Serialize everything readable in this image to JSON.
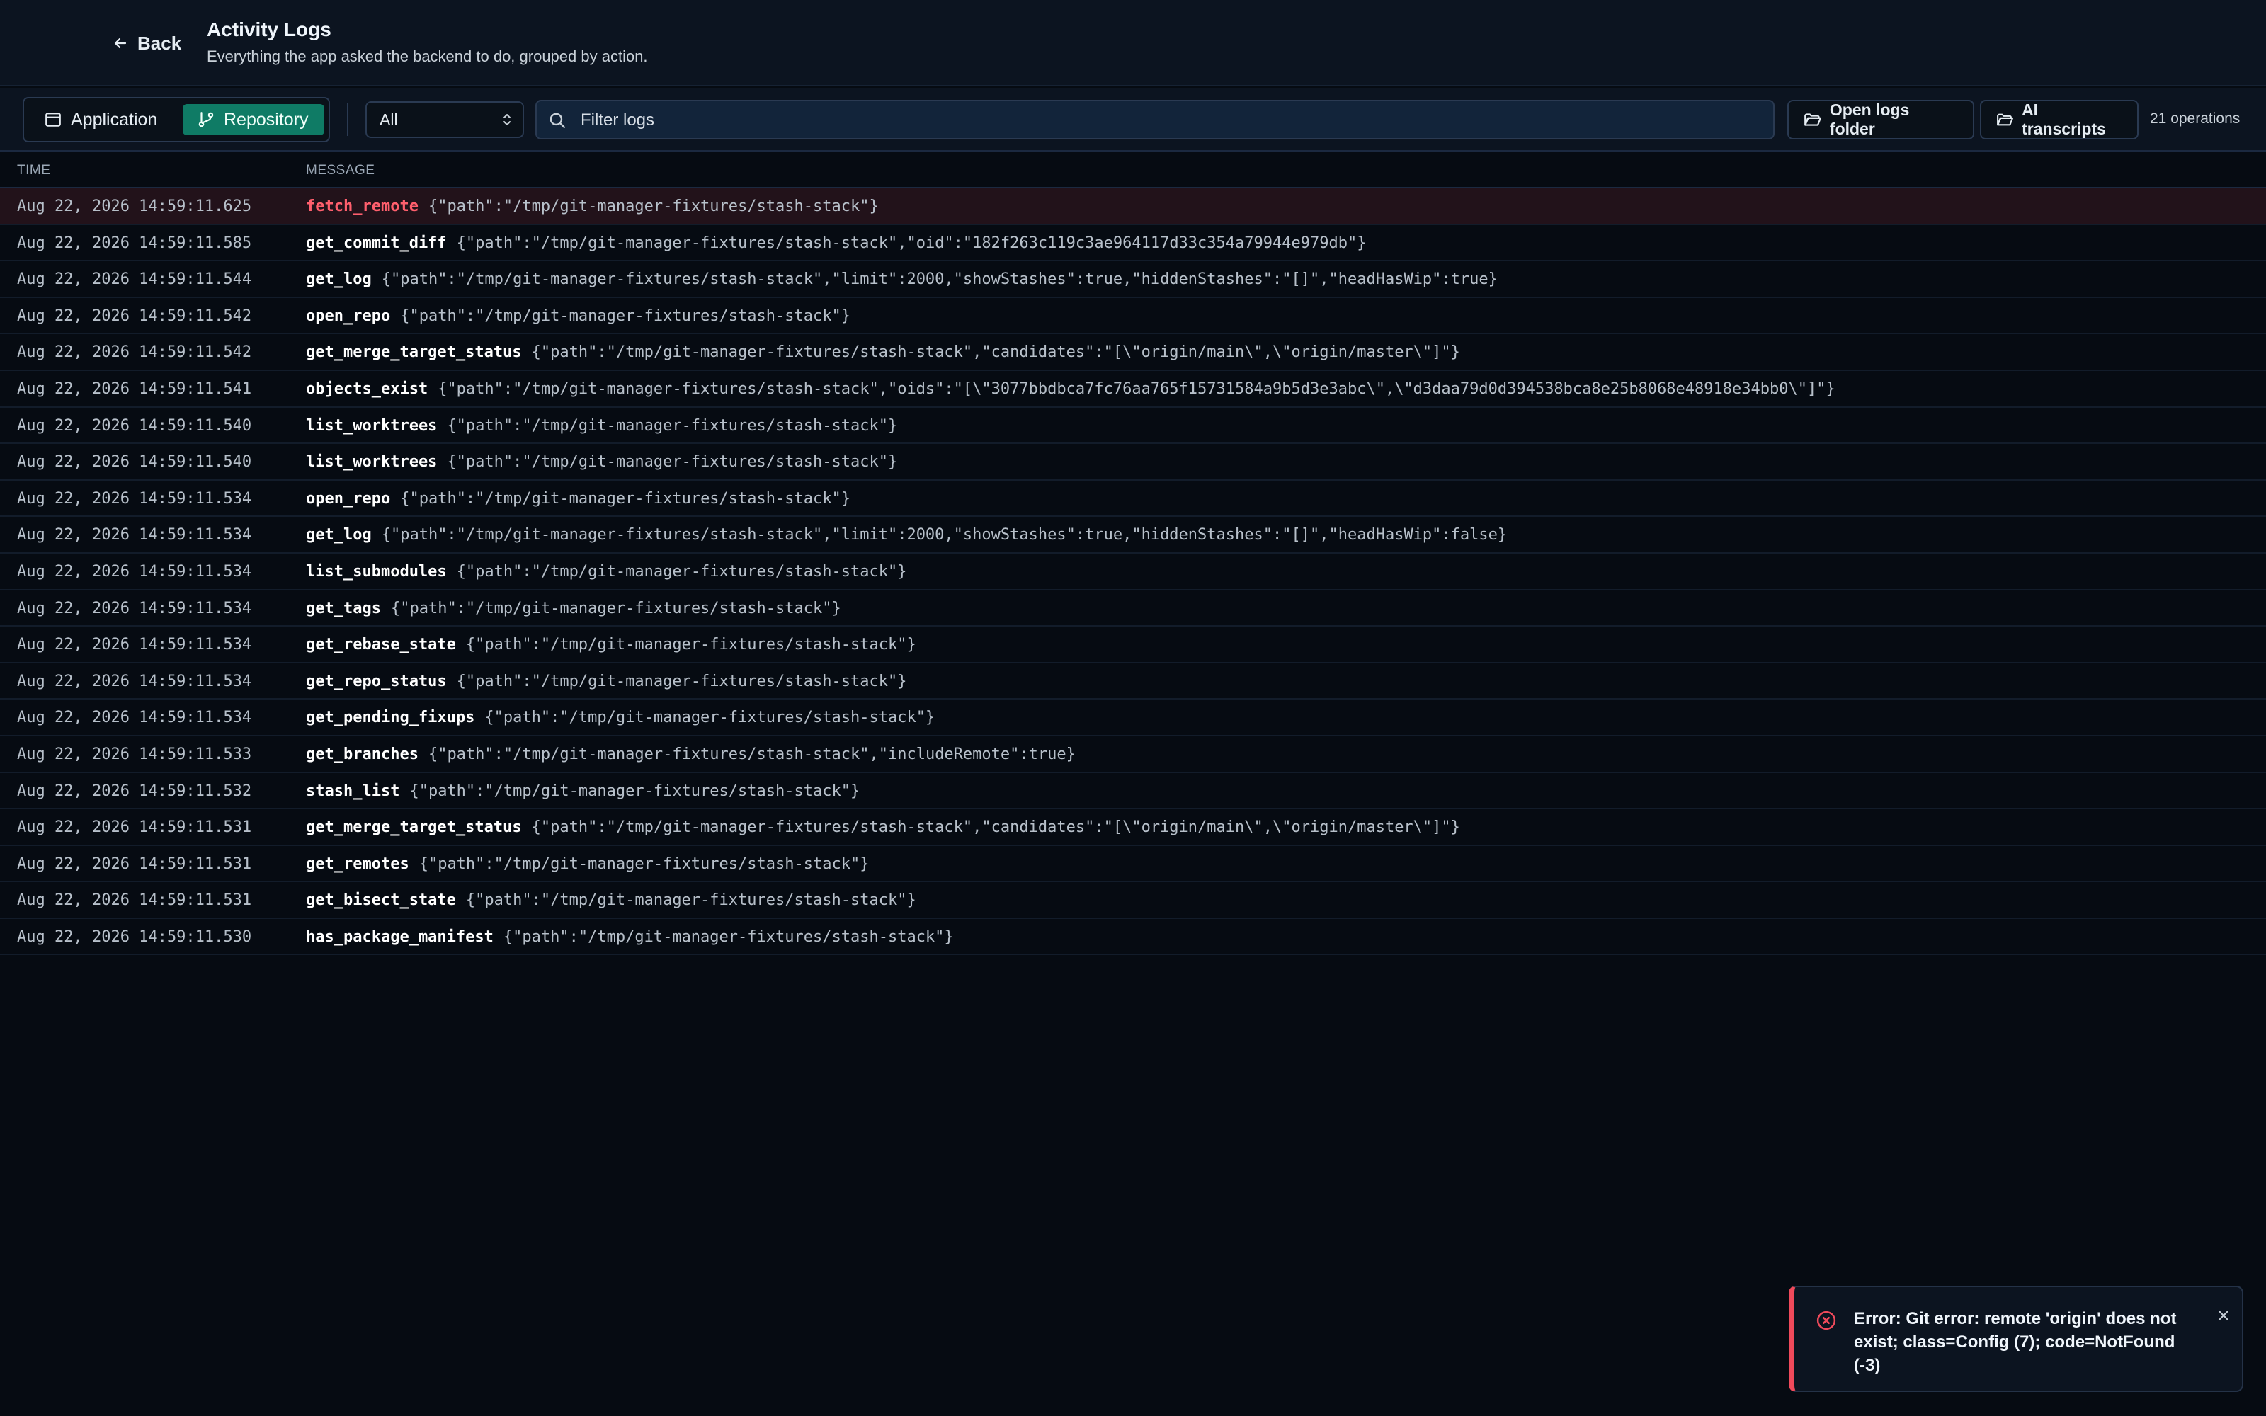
{
  "header": {
    "back_label": "Back",
    "title": "Activity Logs",
    "subtitle": "Everything the app asked the backend to do, grouped by action."
  },
  "toolbar": {
    "scope_tabs": [
      {
        "label": "Application",
        "active": false,
        "icon": "window-icon"
      },
      {
        "label": "Repository",
        "active": true,
        "icon": "git-branch-icon"
      }
    ],
    "filter_select": {
      "value": "All"
    },
    "search": {
      "placeholder": "Filter logs",
      "value": ""
    },
    "open_logs_label": "Open logs folder",
    "ai_transcripts_label": "AI transcripts",
    "operations_count": "21 operations"
  },
  "table": {
    "columns": [
      "TIME",
      "MESSAGE"
    ],
    "rows": [
      {
        "time": "Aug 22, 2026 14:59:11.625",
        "op": "fetch_remote",
        "args": "{\"path\":\"/tmp/git-manager-fixtures/stash-stack\"}",
        "error": true
      },
      {
        "time": "Aug 22, 2026 14:59:11.585",
        "op": "get_commit_diff",
        "args": "{\"path\":\"/tmp/git-manager-fixtures/stash-stack\",\"oid\":\"182f263c119c3ae964117d33c354a79944e979db\"}",
        "error": false
      },
      {
        "time": "Aug 22, 2026 14:59:11.544",
        "op": "get_log",
        "args": "{\"path\":\"/tmp/git-manager-fixtures/stash-stack\",\"limit\":2000,\"showStashes\":true,\"hiddenStashes\":\"[]\",\"headHasWip\":true}",
        "error": false
      },
      {
        "time": "Aug 22, 2026 14:59:11.542",
        "op": "open_repo",
        "args": "{\"path\":\"/tmp/git-manager-fixtures/stash-stack\"}",
        "error": false
      },
      {
        "time": "Aug 22, 2026 14:59:11.542",
        "op": "get_merge_target_status",
        "args": "{\"path\":\"/tmp/git-manager-fixtures/stash-stack\",\"candidates\":\"[\\\"origin/main\\\",\\\"origin/master\\\"]\"}",
        "error": false
      },
      {
        "time": "Aug 22, 2026 14:59:11.541",
        "op": "objects_exist",
        "args": "{\"path\":\"/tmp/git-manager-fixtures/stash-stack\",\"oids\":\"[\\\"3077bbdbca7fc76aa765f15731584a9b5d3e3abc\\\",\\\"d3daa79d0d394538bca8e25b8068e48918e34bb0\\\"]\"}",
        "error": false
      },
      {
        "time": "Aug 22, 2026 14:59:11.540",
        "op": "list_worktrees",
        "args": "{\"path\":\"/tmp/git-manager-fixtures/stash-stack\"}",
        "error": false
      },
      {
        "time": "Aug 22, 2026 14:59:11.540",
        "op": "list_worktrees",
        "args": "{\"path\":\"/tmp/git-manager-fixtures/stash-stack\"}",
        "error": false
      },
      {
        "time": "Aug 22, 2026 14:59:11.534",
        "op": "open_repo",
        "args": "{\"path\":\"/tmp/git-manager-fixtures/stash-stack\"}",
        "error": false
      },
      {
        "time": "Aug 22, 2026 14:59:11.534",
        "op": "get_log",
        "args": "{\"path\":\"/tmp/git-manager-fixtures/stash-stack\",\"limit\":2000,\"showStashes\":true,\"hiddenStashes\":\"[]\",\"headHasWip\":false}",
        "error": false
      },
      {
        "time": "Aug 22, 2026 14:59:11.534",
        "op": "list_submodules",
        "args": "{\"path\":\"/tmp/git-manager-fixtures/stash-stack\"}",
        "error": false
      },
      {
        "time": "Aug 22, 2026 14:59:11.534",
        "op": "get_tags",
        "args": "{\"path\":\"/tmp/git-manager-fixtures/stash-stack\"}",
        "error": false
      },
      {
        "time": "Aug 22, 2026 14:59:11.534",
        "op": "get_rebase_state",
        "args": "{\"path\":\"/tmp/git-manager-fixtures/stash-stack\"}",
        "error": false
      },
      {
        "time": "Aug 22, 2026 14:59:11.534",
        "op": "get_repo_status",
        "args": "{\"path\":\"/tmp/git-manager-fixtures/stash-stack\"}",
        "error": false
      },
      {
        "time": "Aug 22, 2026 14:59:11.534",
        "op": "get_pending_fixups",
        "args": "{\"path\":\"/tmp/git-manager-fixtures/stash-stack\"}",
        "error": false
      },
      {
        "time": "Aug 22, 2026 14:59:11.533",
        "op": "get_branches",
        "args": "{\"path\":\"/tmp/git-manager-fixtures/stash-stack\",\"includeRemote\":true}",
        "error": false
      },
      {
        "time": "Aug 22, 2026 14:59:11.532",
        "op": "stash_list",
        "args": "{\"path\":\"/tmp/git-manager-fixtures/stash-stack\"}",
        "error": false
      },
      {
        "time": "Aug 22, 2026 14:59:11.531",
        "op": "get_merge_target_status",
        "args": "{\"path\":\"/tmp/git-manager-fixtures/stash-stack\",\"candidates\":\"[\\\"origin/main\\\",\\\"origin/master\\\"]\"}",
        "error": false
      },
      {
        "time": "Aug 22, 2026 14:59:11.531",
        "op": "get_remotes",
        "args": "{\"path\":\"/tmp/git-manager-fixtures/stash-stack\"}",
        "error": false
      },
      {
        "time": "Aug 22, 2026 14:59:11.531",
        "op": "get_bisect_state",
        "args": "{\"path\":\"/tmp/git-manager-fixtures/stash-stack\"}",
        "error": false
      },
      {
        "time": "Aug 22, 2026 14:59:11.530",
        "op": "has_package_manifest",
        "args": "{\"path\":\"/tmp/git-manager-fixtures/stash-stack\"}",
        "error": false
      }
    ]
  },
  "toast": {
    "message": "Error: Git error: remote 'origin' does not exist; class=Config (7); code=NotFound (-3)",
    "icon": "error-circle-icon",
    "close_icon": "close-icon"
  },
  "colors": {
    "background": "#060b12",
    "accent": "#0f7b65",
    "error": "#f04a5b",
    "error_text": "#ff5f6d"
  }
}
